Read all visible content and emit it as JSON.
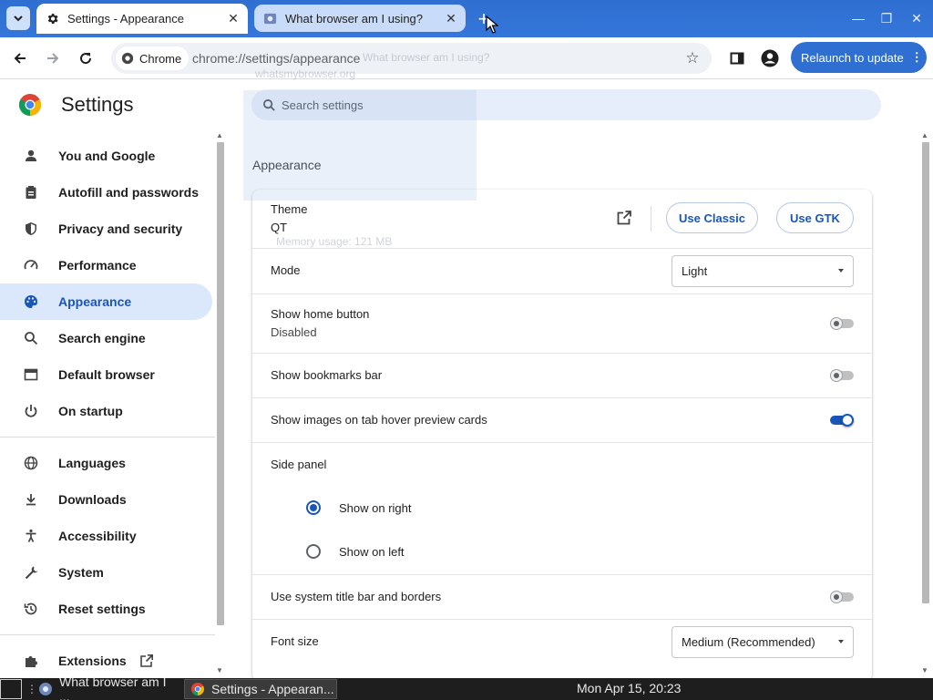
{
  "browser": {
    "tabs": [
      {
        "title": "Settings - Appearance",
        "active": true
      },
      {
        "title": "What browser am I using?",
        "active": false
      }
    ],
    "address": {
      "chip_label": "Chrome",
      "url": "chrome://settings/appearance"
    },
    "relaunch_label": "Relaunch to update"
  },
  "settings": {
    "brand_title": "Settings",
    "search_placeholder": "Search settings",
    "section_title": "Appearance",
    "nav": [
      {
        "label": "You and Google",
        "icon": "person-icon"
      },
      {
        "label": "Autofill and passwords",
        "icon": "clipboard-icon"
      },
      {
        "label": "Privacy and security",
        "icon": "shield-icon"
      },
      {
        "label": "Performance",
        "icon": "speedometer-icon"
      },
      {
        "label": "Appearance",
        "icon": "palette-icon",
        "selected": true
      },
      {
        "label": "Search engine",
        "icon": "search-icon"
      },
      {
        "label": "Default browser",
        "icon": "browser-window-icon"
      },
      {
        "label": "On startup",
        "icon": "power-icon"
      },
      {
        "label": "Languages",
        "icon": "globe-icon"
      },
      {
        "label": "Downloads",
        "icon": "download-icon"
      },
      {
        "label": "Accessibility",
        "icon": "accessibility-icon"
      },
      {
        "label": "System",
        "icon": "wrench-icon"
      },
      {
        "label": "Reset settings",
        "icon": "history-icon"
      },
      {
        "label": "Extensions",
        "icon": "puzzle-icon"
      }
    ],
    "theme": {
      "label": "Theme",
      "value": "QT",
      "use_classic": "Use Classic",
      "use_gtk": "Use GTK"
    },
    "mode": {
      "label": "Mode",
      "value": "Light"
    },
    "home_button": {
      "label": "Show home button",
      "sub": "Disabled",
      "enabled": false
    },
    "bookmarks_bar": {
      "label": "Show bookmarks bar",
      "enabled": false
    },
    "hover_preview": {
      "label": "Show images on tab hover preview cards",
      "enabled": true
    },
    "side_panel": {
      "label": "Side panel",
      "options": [
        "Show on right",
        "Show on left"
      ],
      "selected": "Show on right"
    },
    "system_title_bar": {
      "label": "Use system title bar and borders",
      "enabled": false
    },
    "font_size": {
      "label": "Font size",
      "value": "Medium (Recommended)"
    }
  },
  "ghost_overlay": {
    "line1": "What browser am I using?",
    "line2": "whatsmybrowser.org",
    "line3": "Memory usage: 121 MB"
  },
  "taskbar": {
    "tasks": [
      {
        "label": "What browser am I ..."
      },
      {
        "label": "Settings - Appearan..."
      }
    ],
    "clock": "Mon Apr 15, 20:23"
  },
  "colors": {
    "accent": "#1a56b8",
    "tabstrip": "#3576da",
    "selected_nav_bg": "#dbe7fb"
  }
}
